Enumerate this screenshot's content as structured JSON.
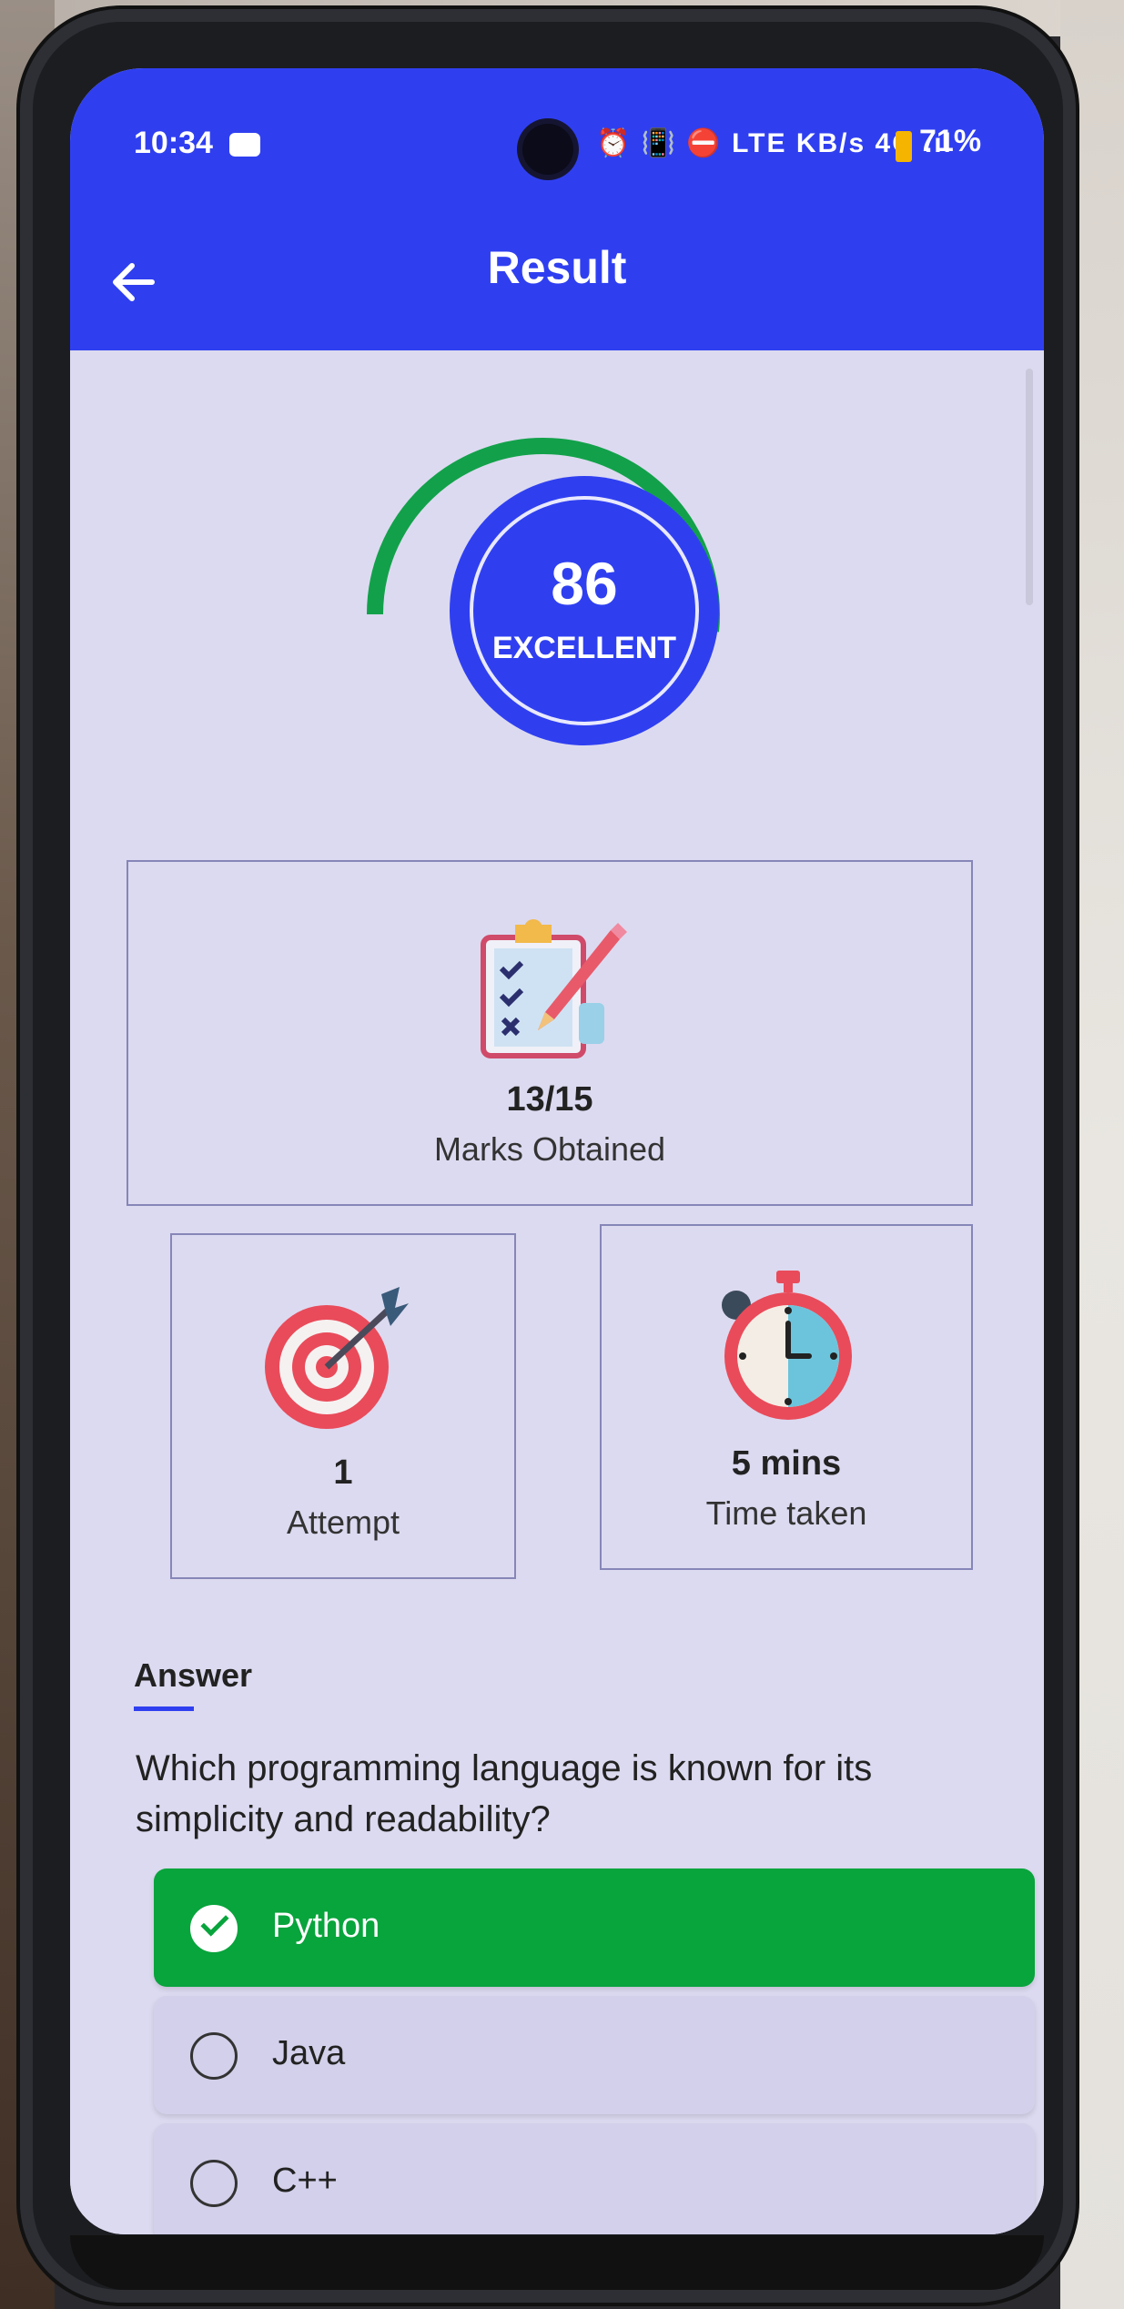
{
  "status_bar": {
    "time": "10:34",
    "indicators": "⏰ 📳 ⛔ LTE KB/s 4G .ıl",
    "battery": "71%"
  },
  "header": {
    "title": "Result",
    "back_icon": "arrow-left-icon"
  },
  "score": {
    "value": "86",
    "label": "EXCELLENT",
    "fraction": 0.86
  },
  "marks": {
    "value": "13/15",
    "label": "Marks Obtained",
    "icon": "clipboard-checklist-icon"
  },
  "attempt": {
    "value": "1",
    "label": "Attempt",
    "icon": "target-icon"
  },
  "time_taken": {
    "value": "5 mins",
    "label": "Time taken",
    "icon": "stopwatch-icon"
  },
  "answer": {
    "section_title": "Answer",
    "question": "Which programming language is known for its simplicity and readability?",
    "options": [
      {
        "label": "Python",
        "correct": true
      },
      {
        "label": "Java",
        "correct": false
      },
      {
        "label": "C++",
        "correct": false
      }
    ]
  },
  "colors": {
    "primary": "#2f3ff0",
    "correct": "#08a43c",
    "gauge_arc": "#12a14a",
    "background": "#dcdaf0"
  }
}
